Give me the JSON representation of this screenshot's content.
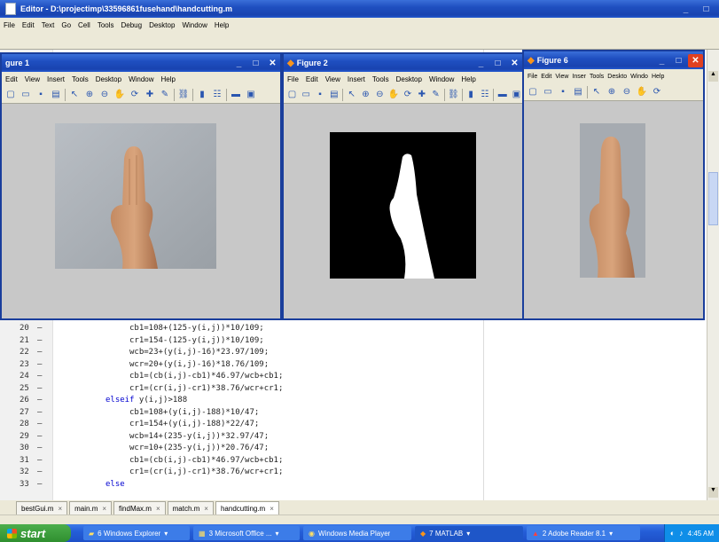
{
  "editor": {
    "title": "Editor - D:\\projectimp\\33596861fusehand\\handcutting.m",
    "menu": [
      "File",
      "Edit",
      "Text",
      "Go",
      "Cell",
      "Tools",
      "Debug",
      "Desktop",
      "Window",
      "Help"
    ]
  },
  "figure1": {
    "title": "gure 1",
    "menu": [
      "Edit",
      "View",
      "Insert",
      "Tools",
      "Desktop",
      "Window",
      "Help"
    ]
  },
  "figure2": {
    "title": "Figure 2",
    "menu": [
      "File",
      "Edit",
      "View",
      "Insert",
      "Tools",
      "Desktop",
      "Window",
      "Help"
    ]
  },
  "figure6": {
    "title": "Figure 6",
    "menu": [
      "File",
      "Edit",
      "View",
      "Inser",
      "Tools",
      "Deskto",
      "Windo",
      "Help"
    ]
  },
  "code_lines": [
    {
      "n": "20",
      "indent": 4,
      "text": "cb1=108+(125-y(i,j))*10/109;"
    },
    {
      "n": "21",
      "indent": 4,
      "text": "cr1=154-(125-y(i,j))*10/109;"
    },
    {
      "n": "22",
      "indent": 4,
      "text": "wcb=23+(y(i,j)-16)*23.97/109;"
    },
    {
      "n": "23",
      "indent": 4,
      "text": "wcr=20+(y(i,j)-16)*18.76/109;"
    },
    {
      "n": "24",
      "indent": 4,
      "text": "cb1=(cb(i,j)-cb1)*46.97/wcb+cb1;"
    },
    {
      "n": "25",
      "indent": 4,
      "text": "cr1=(cr(i,j)-cr1)*38.76/wcr+cr1;"
    },
    {
      "n": "26",
      "indent": 2,
      "kw": "elseif",
      "text": " y(i,j)>188"
    },
    {
      "n": "27",
      "indent": 4,
      "text": "cb1=108+(y(i,j)-188)*10/47;"
    },
    {
      "n": "28",
      "indent": 4,
      "text": "cr1=154+(y(i,j)-188)*22/47;"
    },
    {
      "n": "29",
      "indent": 4,
      "text": "wcb=14+(235-y(i,j))*32.97/47;"
    },
    {
      "n": "30",
      "indent": 4,
      "text": "wcr=10+(235-y(i,j))*20.76/47;"
    },
    {
      "n": "31",
      "indent": 4,
      "text": "cb1=(cb(i,j)-cb1)*46.97/wcb+cb1;"
    },
    {
      "n": "32",
      "indent": 4,
      "text": "cr1=(cr(i,j)-cr1)*38.76/wcr+cr1;"
    },
    {
      "n": "33",
      "indent": 2,
      "kw": "else",
      "text": ""
    }
  ],
  "file_tabs": [
    "bestGui.m",
    "main.m",
    "findMax.m",
    "match.m",
    "handcutting.m"
  ],
  "taskbar": {
    "start": "start",
    "items": [
      "6 Windows Explorer",
      "3 Microsoft Office ...",
      "Windows Media Player",
      "7 MATLAB",
      "2 Adobe Reader 8.1"
    ],
    "clock": "4:45 AM"
  },
  "colors": {
    "xp_blue": "#1f4fc0",
    "task_active": "#1e56c8",
    "close_red": "#e04020"
  }
}
